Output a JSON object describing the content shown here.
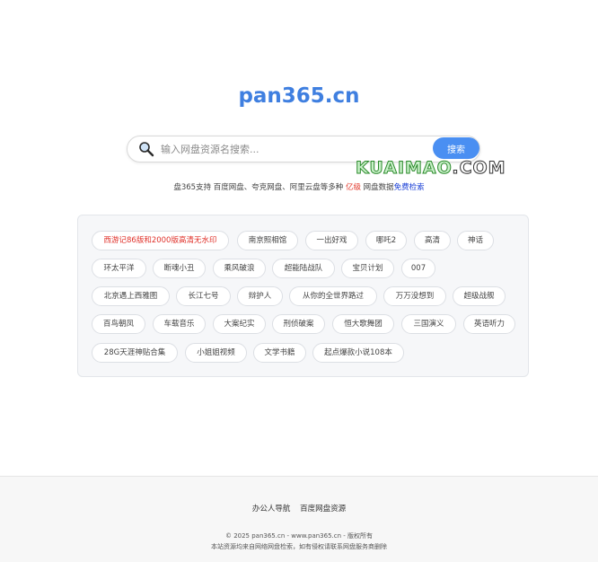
{
  "site": {
    "logo": "pan365.cn"
  },
  "search": {
    "placeholder": "输入网盘资源名搜索...",
    "button_label": "搜索"
  },
  "watermark": {
    "part1": "KUAIMAO",
    "part2": ".COM"
  },
  "subtitle": {
    "prefix": "盘365支持 百度网盘、夸克网盘、阿里云盘等多种 ",
    "highlight": "亿级",
    "middle": " 网盘数据",
    "link": "免费检索"
  },
  "tags": [
    {
      "label": "西游记86版和2000版高清无水印",
      "hot": true
    },
    {
      "label": "南京照相馆"
    },
    {
      "label": "一出好戏"
    },
    {
      "label": "哪吒2"
    },
    {
      "label": "高清"
    },
    {
      "label": "神话"
    },
    {
      "label": "环太平洋"
    },
    {
      "label": "断魂小丑"
    },
    {
      "label": "乘风破浪"
    },
    {
      "label": "超能陆战队"
    },
    {
      "label": "宝贝计划"
    },
    {
      "label": "007"
    },
    {
      "label": "北京遇上西雅图"
    },
    {
      "label": "长江七号"
    },
    {
      "label": "辩护人"
    },
    {
      "label": "从你的全世界路过"
    },
    {
      "label": "万万没想到"
    },
    {
      "label": "超级战舰"
    },
    {
      "label": "百鸟朝凤"
    },
    {
      "label": "车载音乐"
    },
    {
      "label": "大案纪实"
    },
    {
      "label": "刑侦破案"
    },
    {
      "label": "恒大歌舞团"
    },
    {
      "label": "三国演义"
    },
    {
      "label": "英语听力"
    },
    {
      "label": "28G天涯神贴合集"
    },
    {
      "label": "小姐姐视频"
    },
    {
      "label": "文学书籍"
    },
    {
      "label": "起点爆款小说108本"
    }
  ],
  "footer": {
    "links": [
      "办公人导航",
      "百度网盘资源"
    ],
    "copyright": "© 2025 pan365.cn - www.pan365.cn - 版权所有",
    "disclaimer": "本站资源均来自网络网盘检索，如有侵权请联系网盘服务商删除"
  },
  "colors": {
    "accent": "#4a8ff2",
    "logo": "#3f7fe0",
    "hot_tag": "#e0312a",
    "highlight_red": "#e23b2e",
    "highlight_blue": "#1a3fd6"
  },
  "icons": {
    "search": "magnifier-icon"
  }
}
